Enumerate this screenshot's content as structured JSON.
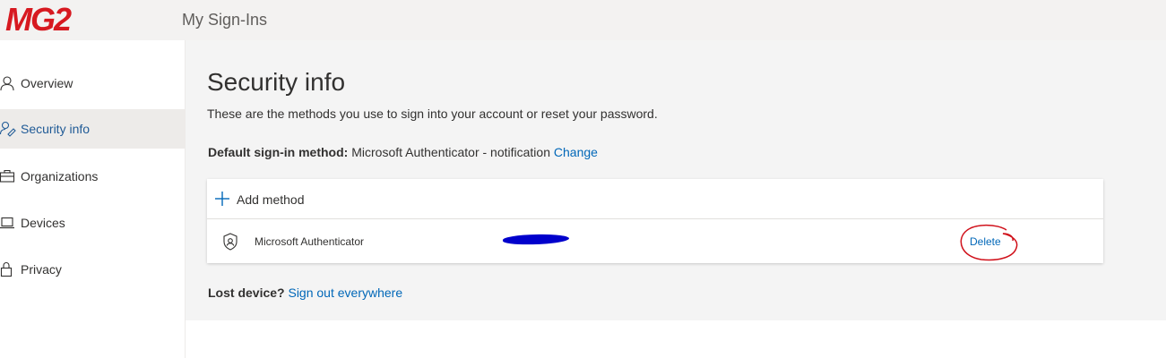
{
  "header": {
    "logo_text": "MG2",
    "app_title": "My Sign-Ins"
  },
  "sidebar": {
    "items": [
      {
        "label": "Overview",
        "icon": "person-icon",
        "active": false
      },
      {
        "label": "Security info",
        "icon": "key-person-icon",
        "active": true
      },
      {
        "label": "Organizations",
        "icon": "briefcase-icon",
        "active": false
      },
      {
        "label": "Devices",
        "icon": "laptop-icon",
        "active": false
      },
      {
        "label": "Privacy",
        "icon": "lock-icon",
        "active": false
      }
    ]
  },
  "main": {
    "title": "Security info",
    "description": "These are the methods you use to sign into your account or reset your password.",
    "default_method_label": "Default sign-in method:",
    "default_method_value": "Microsoft Authenticator - notification",
    "change_link": "Change",
    "add_method_label": "Add method",
    "methods": [
      {
        "name": "Microsoft Authenticator",
        "icon": "authenticator-icon",
        "delete_label": "Delete"
      }
    ],
    "lost_device_label": "Lost device?",
    "sign_out_link": "Sign out everywhere"
  },
  "colors": {
    "brand": "#d71920",
    "link": "#0067b8",
    "active_nav_text": "#1f5a96",
    "redaction": "#0000cc",
    "annotation": "#d0101a"
  }
}
